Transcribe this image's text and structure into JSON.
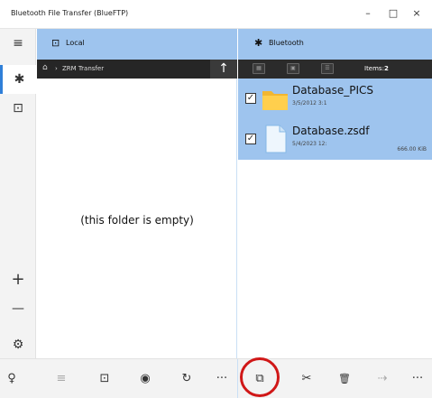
{
  "window": {
    "title": "Bluetooth File Transfer (BlueFTP)",
    "minimize": "–",
    "maximize": "□",
    "close": "×"
  },
  "left_pane": {
    "header_label": "Local",
    "path": {
      "home_icon": "home-icon",
      "separator": "›",
      "folder": "ZRM Transfer"
    },
    "up_arrow": "↑",
    "empty_text": "(this folder is empty)"
  },
  "right_pane": {
    "header_label": "Bluetooth",
    "items_label": "Items:",
    "items_count": "2",
    "files": [
      {
        "name": "Database_PICS",
        "date": "3/5/2012 3:1",
        "size": "",
        "type": "folder",
        "checked": true
      },
      {
        "name": "Database.zsdf",
        "date": "5/4/2023 12:",
        "size": "666.00 KiB",
        "type": "file",
        "checked": true
      }
    ]
  },
  "rail": {
    "menu": "≡",
    "bluetooth": "✱",
    "local": "⊡",
    "zoom_in": "+",
    "zoom_out": "—",
    "settings": "⚙",
    "tips": "♡"
  },
  "bottom_left": {
    "btn1": "≡",
    "btn2": "⊡",
    "btn3": "◉",
    "btn4": "↻",
    "more": "···"
  },
  "bottom_right": {
    "copy": "⧉",
    "cut": "✂",
    "delete": "🗑",
    "send": "⇢",
    "more": "···"
  },
  "colors": {
    "accent": "#9ec4ee",
    "dark": "#262626",
    "highlight": "#d01717"
  }
}
